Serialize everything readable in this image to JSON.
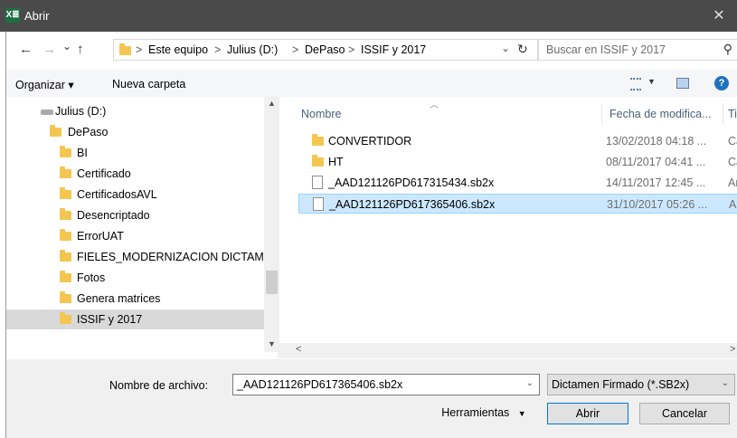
{
  "window": {
    "title": "Abrir",
    "app_icon": "X≣",
    "close": "✕"
  },
  "address": {
    "back": "←",
    "forward": "→",
    "recent": "⌄",
    "up": "↑",
    "crumbs": [
      "Este equipo",
      "Julius (D:)",
      "DePaso",
      "ISSIF y 2017"
    ],
    "sep": ">",
    "refresh": "↻",
    "dropdown": "⌄"
  },
  "search": {
    "placeholder": "Buscar en ISSIF y 2017",
    "icon": "⚲"
  },
  "toolbar": {
    "organize": "Organizar ▾",
    "new_folder": "Nueva carpeta",
    "help": "?"
  },
  "sidebar": {
    "items": [
      {
        "label": "Julius (D:)",
        "type": "drive"
      },
      {
        "label": "DePaso",
        "type": "folder"
      },
      {
        "label": "BI",
        "type": "folder"
      },
      {
        "label": "Certificado",
        "type": "folder"
      },
      {
        "label": "CertificadosAVL",
        "type": "folder"
      },
      {
        "label": "Desencriptado",
        "type": "folder"
      },
      {
        "label": "ErrorUAT",
        "type": "folder"
      },
      {
        "label": "FIELES_MODERNIZACION DICTAMEN",
        "type": "folder"
      },
      {
        "label": "Fotos",
        "type": "folder"
      },
      {
        "label": "Genera matrices",
        "type": "folder"
      },
      {
        "label": "ISSIF y 2017",
        "type": "folder",
        "selected": true
      }
    ]
  },
  "files": {
    "columns": {
      "name": "Nombre",
      "date": "Fecha de modifica...",
      "type": "Ti"
    },
    "rows": [
      {
        "name": "CONVERTIDOR",
        "date": "13/02/2018 04:18 ...",
        "type": "Ca",
        "kind": "folder"
      },
      {
        "name": "HT",
        "date": "08/11/2017 04:41 ...",
        "type": "Ca",
        "kind": "folder"
      },
      {
        "name": "_AAD121126PD617315434.sb2x",
        "date": "14/11/2017 12:45 ...",
        "type": "Ar",
        "kind": "file"
      },
      {
        "name": "_AAD121126PD617365406.sb2x",
        "date": "31/10/2017 05:26 ...",
        "type": "Ar",
        "kind": "file",
        "selected": true
      }
    ]
  },
  "bottom": {
    "filename_label": "Nombre de archivo:",
    "filename_value": "_AAD121126PD617365406.sb2x",
    "filter_value": "Dictamen Firmado (*.SB2x)",
    "tools": "Herramientas",
    "open": "Abrir",
    "cancel": "Cancelar"
  }
}
